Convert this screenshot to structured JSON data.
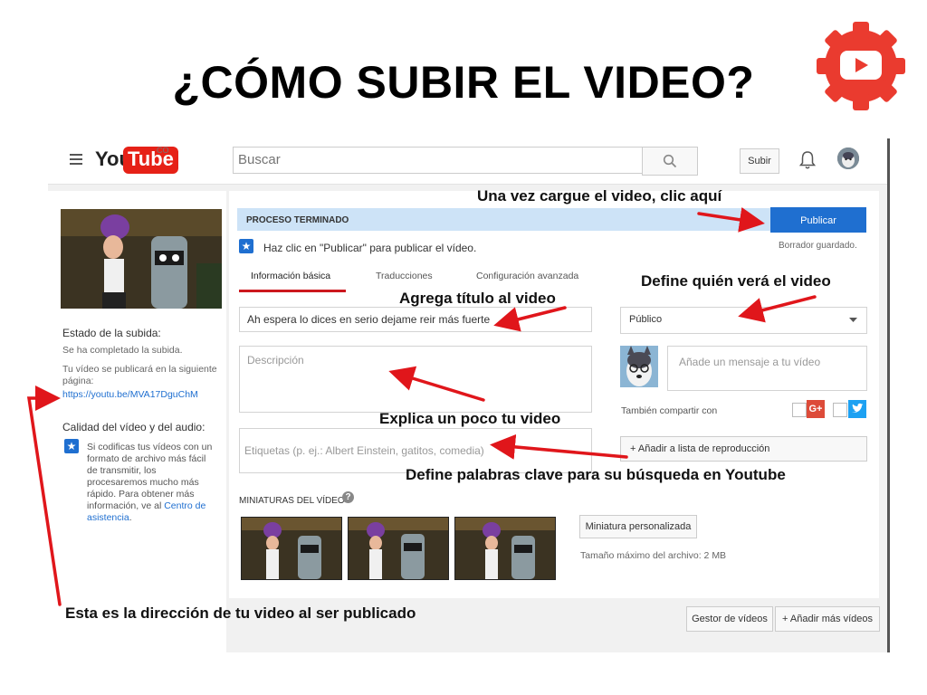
{
  "slide": {
    "title": "¿CÓMO SUBIR EL VIDEO?"
  },
  "youtube": {
    "logo_you": "You",
    "logo_tube": "Tube",
    "logo_country": "CO",
    "search_placeholder": "Buscar",
    "upload_label": "Subir"
  },
  "left_panel": {
    "upload_status_title": "Estado de la subida:",
    "upload_complete": "Se ha completado la subida.",
    "publish_info": "Tu vídeo se publicará en la siguiente página:",
    "video_url": "https://youtu.be/MVA17DguChM",
    "quality_title": "Calidad del vídeo y del audio:",
    "quality_text": "Si codificas tus vídeos con un formato de archivo más fácil de transmitir, los procesaremos mucho más rápido. Para obtener más información, ve al ",
    "help_link": "Centro de asistencia",
    "help_suffix": "."
  },
  "main": {
    "status": "PROCESO TERMINADO",
    "publish_button": "Publicar",
    "draft_saved": "Borrador guardado.",
    "hint": "Haz clic en \"Publicar\" para publicar el vídeo.",
    "tabs": [
      {
        "label": "Información básica",
        "active": true
      },
      {
        "label": "Traducciones",
        "active": false
      },
      {
        "label": "Configuración avanzada",
        "active": false
      }
    ],
    "title_value": "Ah espera lo dices en serio dejame reir más fuerte",
    "description_placeholder": "Descripción",
    "tags_placeholder": "Etiquetas (p. ej.: Albert Einstein, gatitos, comedia)",
    "privacy_value": "Público",
    "message_placeholder": "Añade un mensaje a tu vídeo",
    "share_label": "También compartir con",
    "playlist_button": "+ Añadir a lista de reproducción",
    "thumbnails_title": "MINIATURAS DEL VÍDEO",
    "custom_thumb_button": "Miniatura personalizada",
    "max_size": "Tamaño máximo del archivo: 2 MB"
  },
  "bottom": {
    "video_manager": "Gestor de vídeos",
    "add_more": "+ Añadir más vídeos"
  },
  "annotations": {
    "publish": "Una vez cargue el video, clic aquí",
    "privacy": "Define quién verá el video",
    "title": "Agrega título al video",
    "description": "Explica un poco tu video",
    "tags": "Define palabras clave para su búsqueda en Youtube",
    "url": "Esta es la dirección de tu video al ser publicado"
  },
  "colors": {
    "youtube_red": "#e62117",
    "publish_blue": "#1f6fd0",
    "arrow_red": "#e0161b"
  }
}
